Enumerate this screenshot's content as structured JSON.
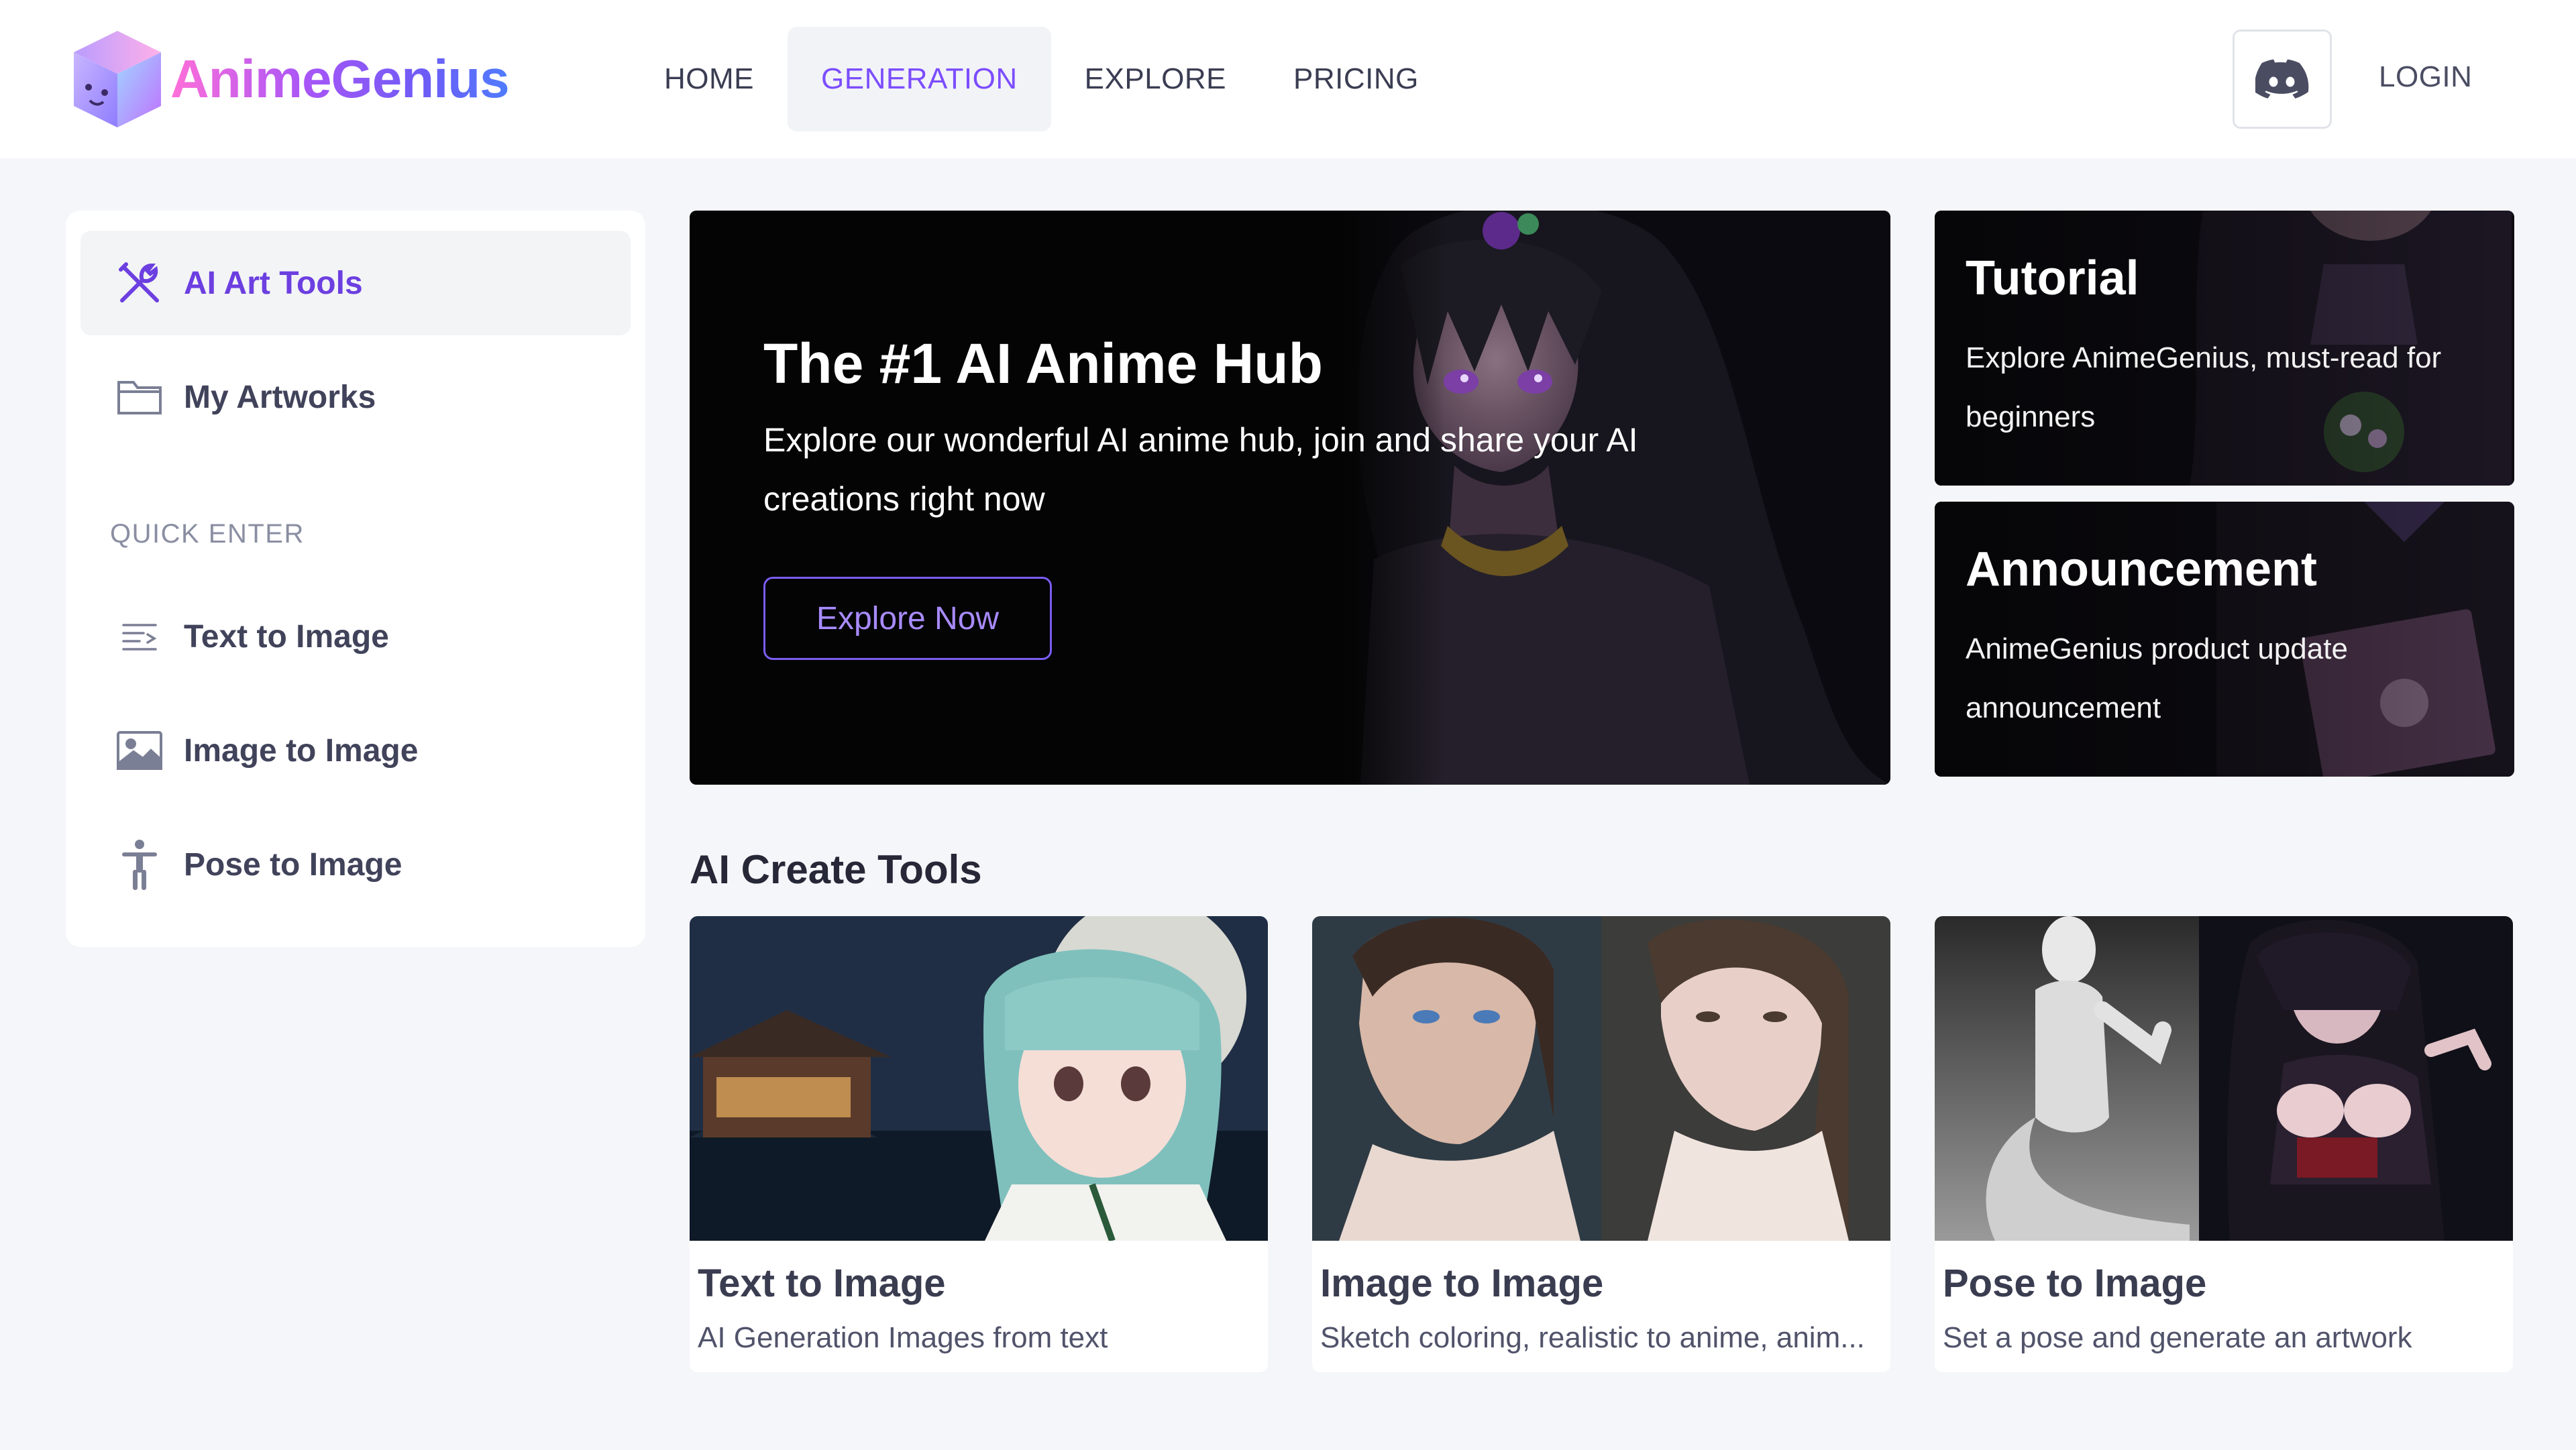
{
  "brand": {
    "name": "AnimeGenius"
  },
  "nav": {
    "items": [
      {
        "label": "HOME"
      },
      {
        "label": "GENERATION"
      },
      {
        "label": "EXPLORE"
      },
      {
        "label": "PRICING"
      }
    ],
    "active": "GENERATION",
    "login_label": "LOGIN"
  },
  "sidebar": {
    "items": [
      {
        "label": "AI Art Tools",
        "icon": "tools-icon"
      },
      {
        "label": "My Artworks",
        "icon": "folder-icon"
      }
    ],
    "section_label": "QUICK ENTER",
    "quick": [
      {
        "label": "Text to Image",
        "icon": "text-lines-icon"
      },
      {
        "label": "Image to Image",
        "icon": "image-icon"
      },
      {
        "label": "Pose to Image",
        "icon": "person-pose-icon"
      }
    ]
  },
  "hero": {
    "title": "The #1 AI Anime Hub",
    "subtitle": "Explore our wonderful AI anime hub, join and share your AI creations right now",
    "button": "Explore Now"
  },
  "cards": [
    {
      "title": "Tutorial",
      "desc": "Explore AnimeGenius, must-read for beginners"
    },
    {
      "title": "Announcement",
      "desc": "AnimeGenius product update announcement"
    }
  ],
  "tools": {
    "section_title": "AI Create Tools",
    "items": [
      {
        "title": "Text to Image",
        "desc": "AI Generation Images from text"
      },
      {
        "title": "Image to Image",
        "desc": "Sketch coloring, realistic to anime, anim..."
      },
      {
        "title": "Pose to Image",
        "desc": "Set a pose and generate an artwork"
      }
    ]
  },
  "colors": {
    "accent": "#7c4dff",
    "header_bg": "#ffffff",
    "page_bg": "#f5f6f9",
    "hero_bg": "#040404"
  }
}
